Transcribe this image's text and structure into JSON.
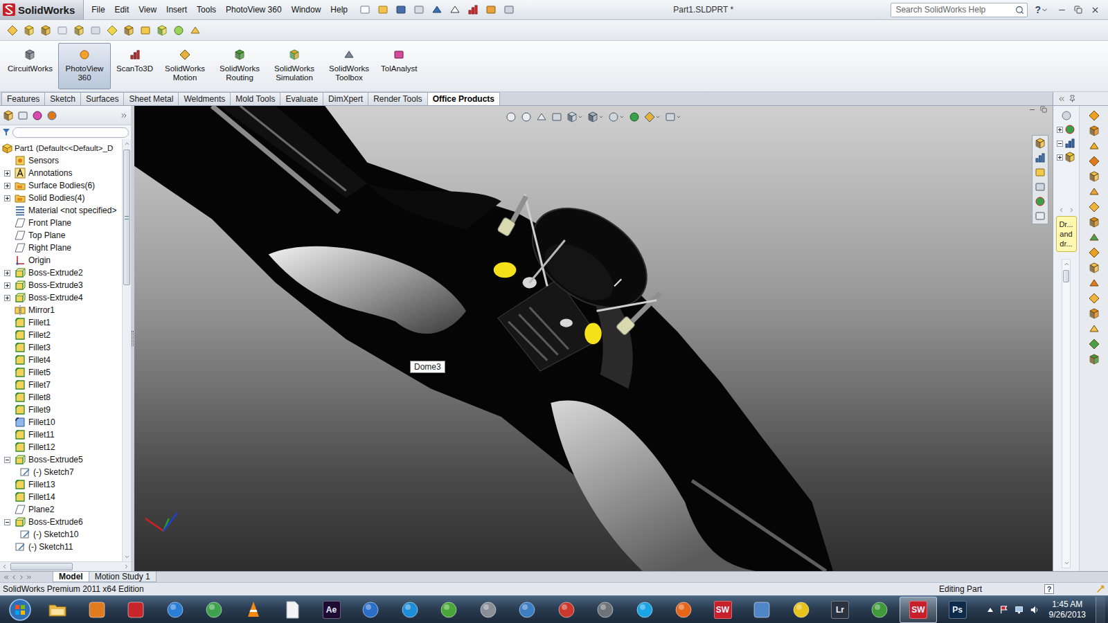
{
  "app": {
    "name": "SolidWorks"
  },
  "menu": [
    "File",
    "Edit",
    "View",
    "Insert",
    "Tools",
    "PhotoView 360",
    "Window",
    "Help"
  ],
  "window": {
    "title": "Part1.SLDPRT *"
  },
  "search": {
    "placeholder": "Search SolidWorks Help"
  },
  "help": "?",
  "commands": [
    {
      "label": "CircuitWorks",
      "selected": false
    },
    {
      "label": "PhotoView 360",
      "selected": true
    },
    {
      "label": "ScanTo3D",
      "selected": false
    },
    {
      "label": "SolidWorks Motion",
      "selected": false
    },
    {
      "label": "SolidWorks Routing",
      "selected": false
    },
    {
      "label": "SolidWorks Simulation",
      "selected": false
    },
    {
      "label": "SolidWorks Toolbox",
      "selected": false
    },
    {
      "label": "TolAnalyst",
      "selected": false
    }
  ],
  "tabs": [
    {
      "label": "Features",
      "selected": false
    },
    {
      "label": "Sketch",
      "selected": false
    },
    {
      "label": "Surfaces",
      "selected": false
    },
    {
      "label": "Sheet Metal",
      "selected": false
    },
    {
      "label": "Weldments",
      "selected": false
    },
    {
      "label": "Mold Tools",
      "selected": false
    },
    {
      "label": "Evaluate",
      "selected": false
    },
    {
      "label": "DimXpert",
      "selected": false
    },
    {
      "label": "Render Tools",
      "selected": false
    },
    {
      "label": "Office Products",
      "selected": true
    }
  ],
  "tree": [
    {
      "label": "Part1 (Default<<Default>_D",
      "level": 0,
      "kind": "part",
      "expandable": false,
      "expanded": false
    },
    {
      "label": "Sensors",
      "level": 1,
      "kind": "sensor",
      "expandable": false,
      "expanded": false
    },
    {
      "label": "Annotations",
      "level": 1,
      "kind": "annotation",
      "expandable": true,
      "expanded": false
    },
    {
      "label": "Surface Bodies(6)",
      "level": 1,
      "kind": "folder",
      "expandable": true,
      "expanded": false
    },
    {
      "label": "Solid Bodies(4)",
      "level": 1,
      "kind": "folder",
      "expandable": true,
      "expanded": false
    },
    {
      "label": "Material <not specified>",
      "level": 1,
      "kind": "material",
      "expandable": false,
      "expanded": false
    },
    {
      "label": "Front Plane",
      "level": 1,
      "kind": "plane",
      "expandable": false,
      "expanded": false
    },
    {
      "label": "Top Plane",
      "level": 1,
      "kind": "plane",
      "expandable": false,
      "expanded": false
    },
    {
      "label": "Right Plane",
      "level": 1,
      "kind": "plane",
      "expandable": false,
      "expanded": false
    },
    {
      "label": "Origin",
      "level": 1,
      "kind": "origin",
      "expandable": false,
      "expanded": false
    },
    {
      "label": "Boss-Extrude2",
      "level": 1,
      "kind": "extrude",
      "expandable": true,
      "expanded": false
    },
    {
      "label": "Boss-Extrude3",
      "level": 1,
      "kind": "extrude",
      "expandable": true,
      "expanded": false
    },
    {
      "label": "Boss-Extrude4",
      "level": 1,
      "kind": "extrude",
      "expandable": true,
      "expanded": false
    },
    {
      "label": "Mirror1",
      "level": 1,
      "kind": "mirror",
      "expandable": false,
      "expanded": false
    },
    {
      "label": "Fillet1",
      "level": 1,
      "kind": "fillet",
      "expandable": false,
      "expanded": false
    },
    {
      "label": "Fillet2",
      "level": 1,
      "kind": "fillet",
      "expandable": false,
      "expanded": false
    },
    {
      "label": "Fillet3",
      "level": 1,
      "kind": "fillet",
      "expandable": false,
      "expanded": false
    },
    {
      "label": "Fillet4",
      "level": 1,
      "kind": "fillet",
      "expandable": false,
      "expanded": false
    },
    {
      "label": "Fillet5",
      "level": 1,
      "kind": "fillet",
      "expandable": false,
      "expanded": false
    },
    {
      "label": "Fillet7",
      "level": 1,
      "kind": "fillet",
      "expandable": false,
      "expanded": false
    },
    {
      "label": "Fillet8",
      "level": 1,
      "kind": "fillet",
      "expandable": false,
      "expanded": false
    },
    {
      "label": "Fillet9",
      "level": 1,
      "kind": "fillet",
      "expandable": false,
      "expanded": false
    },
    {
      "label": "Fillet10",
      "level": 1,
      "kind": "variable-fillet",
      "expandable": false,
      "expanded": false
    },
    {
      "label": "Fillet11",
      "level": 1,
      "kind": "fillet",
      "expandable": false,
      "expanded": false
    },
    {
      "label": "Fillet12",
      "level": 1,
      "kind": "fillet",
      "expandable": false,
      "expanded": false
    },
    {
      "label": "Boss-Extrude5",
      "level": 1,
      "kind": "extrude",
      "expandable": true,
      "expanded": true
    },
    {
      "label": "(-) Sketch7",
      "level": 2,
      "kind": "sketch",
      "expandable": false,
      "expanded": false
    },
    {
      "label": "Fillet13",
      "level": 1,
      "kind": "fillet",
      "expandable": false,
      "expanded": false
    },
    {
      "label": "Fillet14",
      "level": 1,
      "kind": "fillet",
      "expandable": false,
      "expanded": false
    },
    {
      "label": "Plane2",
      "level": 1,
      "kind": "plane",
      "expandable": false,
      "expanded": false
    },
    {
      "label": "Boss-Extrude6",
      "level": 1,
      "kind": "extrude",
      "expandable": true,
      "expanded": true
    },
    {
      "label": "(-) Sketch10",
      "level": 2,
      "kind": "sketch",
      "expandable": false,
      "expanded": false
    },
    {
      "label": "(-) Sketch11",
      "level": 1,
      "kind": "sketch",
      "expandable": false,
      "expanded": false
    }
  ],
  "viewport": {
    "tooltip": "Dome3"
  },
  "task_pane": {
    "note": [
      "Dr...",
      "and",
      "dr..."
    ]
  },
  "bottom_tabs": [
    {
      "label": "Model",
      "selected": true
    },
    {
      "label": "Motion Study 1",
      "selected": false
    }
  ],
  "status_bar": {
    "edition": "SolidWorks Premium 2011 x64 Edition",
    "mode": "Editing Part",
    "help": "?"
  },
  "taskbar": {
    "apps": [
      {
        "kind": "folder",
        "color": "#e8b84a",
        "active": false
      },
      {
        "kind": "square",
        "color": "#e07b1f",
        "active": false
      },
      {
        "kind": "square",
        "color": "#c8252b",
        "active": false
      },
      {
        "kind": "circle",
        "color": "#2a7fd4",
        "active": false
      },
      {
        "kind": "circle",
        "color": "#3fa34d",
        "active": false
      },
      {
        "kind": "cone",
        "color": "#f08a12",
        "active": false
      },
      {
        "kind": "page",
        "color": "#f4f4f4",
        "active": false
      },
      {
        "kind": "badge",
        "label": "Ae",
        "color": "#1f0a33",
        "active": false
      },
      {
        "kind": "circle",
        "color": "#2b6fc9",
        "active": false
      },
      {
        "kind": "circle",
        "color": "#1d8fd8",
        "active": false
      },
      {
        "kind": "circle",
        "color": "#4aa83a",
        "active": false
      },
      {
        "kind": "circle",
        "color": "#8a8f96",
        "active": false
      },
      {
        "kind": "circle",
        "color": "#3d7fc4",
        "active": false
      },
      {
        "kind": "circle",
        "color": "#c93a2c",
        "active": false
      },
      {
        "kind": "circle",
        "color": "#6f747a",
        "active": false
      },
      {
        "kind": "circle",
        "color": "#1aa4e6",
        "active": false
      },
      {
        "kind": "circle",
        "color": "#e5661b",
        "active": false
      },
      {
        "kind": "badge",
        "label": "SW",
        "color": "#c8202a",
        "active": false
      },
      {
        "kind": "square",
        "color": "#4f86c6",
        "active": false
      },
      {
        "kind": "circle",
        "color": "#e7c21a",
        "active": false
      },
      {
        "kind": "badge",
        "label": "Lr",
        "color": "#2b3340",
        "active": false
      },
      {
        "kind": "circle",
        "color": "#3f9a3a",
        "active": false
      },
      {
        "kind": "badge",
        "label": "SW",
        "color": "#c8202a",
        "active": true
      },
      {
        "kind": "badge",
        "label": "Ps",
        "color": "#0d2a4a",
        "active": false
      }
    ],
    "time": "1:45 AM",
    "date": "9/26/2013"
  }
}
